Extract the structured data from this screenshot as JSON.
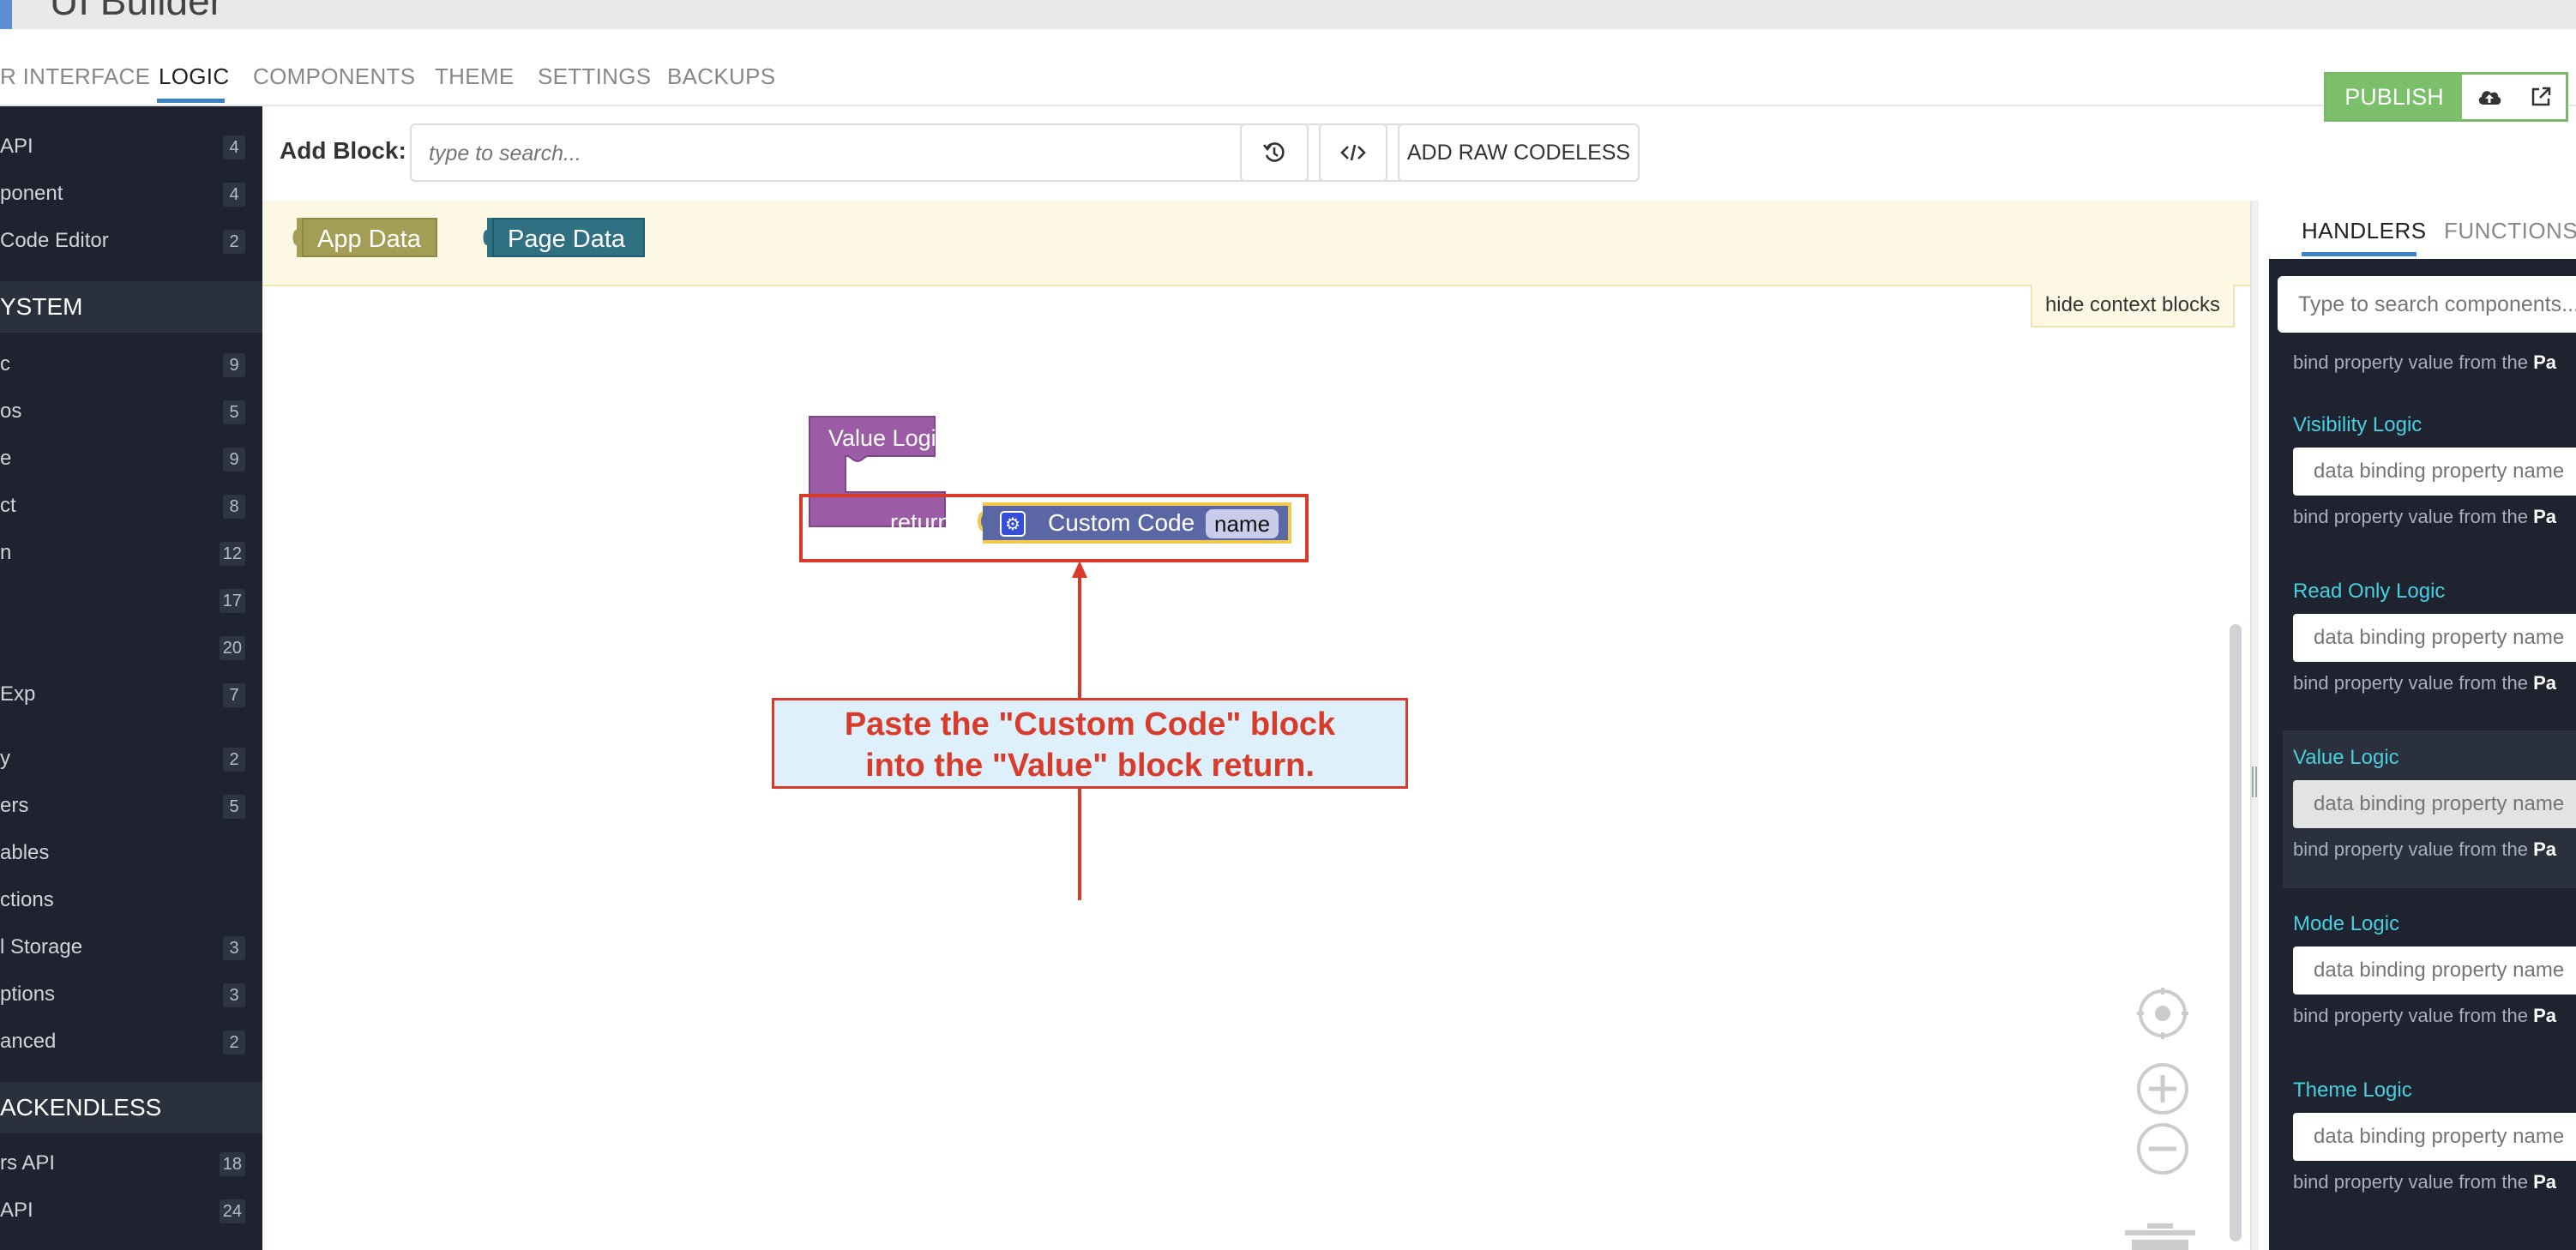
{
  "header": {
    "app_title": "UI Builder"
  },
  "nav": {
    "tabs": [
      "R INTERFACE",
      "LOGIC",
      "COMPONENTS",
      "THEME",
      "SETTINGS",
      "BACKUPS"
    ],
    "active_tab": "LOGIC",
    "publish_label": "PUBLISH"
  },
  "sidebar": {
    "items_top": [
      {
        "label": "API",
        "count": "4"
      },
      {
        "label": "ponent",
        "count": "4"
      },
      {
        "label": "Code Editor",
        "count": "2"
      }
    ],
    "system_header": "YSTEM",
    "system_items": [
      {
        "label": "c",
        "count": "9"
      },
      {
        "label": "os",
        "count": "5"
      },
      {
        "label": "e",
        "count": "9"
      },
      {
        "label": "ct",
        "count": "8"
      },
      {
        "label": "n",
        "count": "12"
      },
      {
        "label": "",
        "count": "17"
      },
      {
        "label": "",
        "count": "20"
      },
      {
        "label": "Exp",
        "count": "7"
      },
      {
        "label": "y",
        "count": "2"
      },
      {
        "label": "ers",
        "count": "5"
      },
      {
        "label": "ables",
        "count": ""
      },
      {
        "label": "ctions",
        "count": ""
      },
      {
        "label": "l Storage",
        "count": "3"
      },
      {
        "label": "ptions",
        "count": "3"
      },
      {
        "label": "anced",
        "count": "2"
      }
    ],
    "backendless_header": "ACKENDLESS",
    "backendless_items": [
      {
        "label": "rs API",
        "count": "18"
      },
      {
        "label": "API",
        "count": "24"
      }
    ]
  },
  "toolbar": {
    "add_block_label": "Add Block:",
    "search_placeholder": "type to search...",
    "raw_codeless_label": "ADD RAW CODELESS"
  },
  "canvas": {
    "context_blocks": [
      "App Data",
      "Page Data"
    ],
    "hide_context_label": "hide context blocks",
    "value_block_title": "Value Logic",
    "return_label": "return",
    "custom_code_label": "Custom Code",
    "name_chip": "name"
  },
  "annotation": {
    "line1": "Paste the \"Custom Code\" block",
    "line2": "into the \"Value\" block return."
  },
  "right_panel": {
    "tabs": [
      "HANDLERS",
      "FUNCTIONS"
    ],
    "active_tab": "HANDLERS",
    "search_placeholder": "Type to search components...",
    "hint_prefix": "bind property value from the",
    "hint_suffix": "Pa",
    "field_placeholder": "data binding property name",
    "sections": [
      {
        "title": "Visibility Logic"
      },
      {
        "title": "Read Only Logic"
      },
      {
        "title": "Value Logic",
        "disabled": true
      },
      {
        "title": "Mode Logic"
      },
      {
        "title": "Theme Logic"
      }
    ]
  },
  "colors": {
    "accent": "#3d82c4",
    "publish_green": "#7bbf6a",
    "block_purple": "#9b5ba5",
    "custom_code_blue": "#5b67a5",
    "annotation_red": "#d93b2a",
    "sidebar_bg": "#1f2330",
    "handler_title_cyan": "#48d0e0"
  }
}
